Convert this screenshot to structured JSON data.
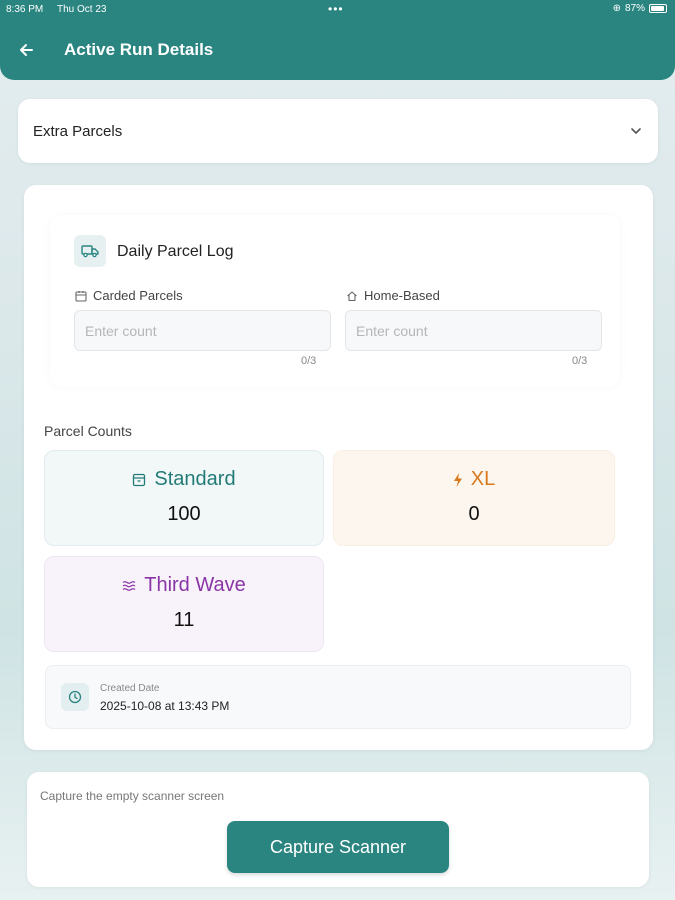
{
  "status_bar": {
    "time": "8:36 PM",
    "date": "Thu Oct 23",
    "dots": "•••",
    "battery": "87%"
  },
  "header": {
    "back_icon": "arrow-left-icon",
    "title": "Active Run Details"
  },
  "extra_parcels": {
    "label": "Extra Parcels",
    "icon": "chevron-down-icon"
  },
  "daily_log": {
    "title": "Daily Parcel Log",
    "icon": "truck-icon",
    "fields": [
      {
        "label": "Carded Parcels",
        "icon": "calendar-icon",
        "placeholder": "Enter count",
        "value": "",
        "counter": "0/3"
      },
      {
        "label": "Home-Based",
        "icon": "home-icon",
        "placeholder": "Enter count",
        "value": "",
        "counter": "0/3"
      }
    ]
  },
  "parcel_counts": {
    "heading": "Parcel Counts",
    "tiles": [
      {
        "label": "Standard",
        "icon": "box-icon",
        "value": "100",
        "color": "#237b77"
      },
      {
        "label": "XL",
        "icon": "bolt-icon",
        "value": "0",
        "color": "#d8791d"
      },
      {
        "label": "Third Wave",
        "icon": "waves-icon",
        "value": "11",
        "color": "#8a35a6"
      }
    ]
  },
  "created": {
    "label": "Created Date",
    "value": "2025-10-08 at 13:43 PM",
    "icon": "clock-icon"
  },
  "scanner": {
    "hint": "Capture the empty scanner screen",
    "button_label": "Capture Scanner"
  },
  "colors": {
    "primary": "#2a8581",
    "standard": "#237b77",
    "xl": "#d8791d",
    "third_wave": "#8a35a6"
  }
}
